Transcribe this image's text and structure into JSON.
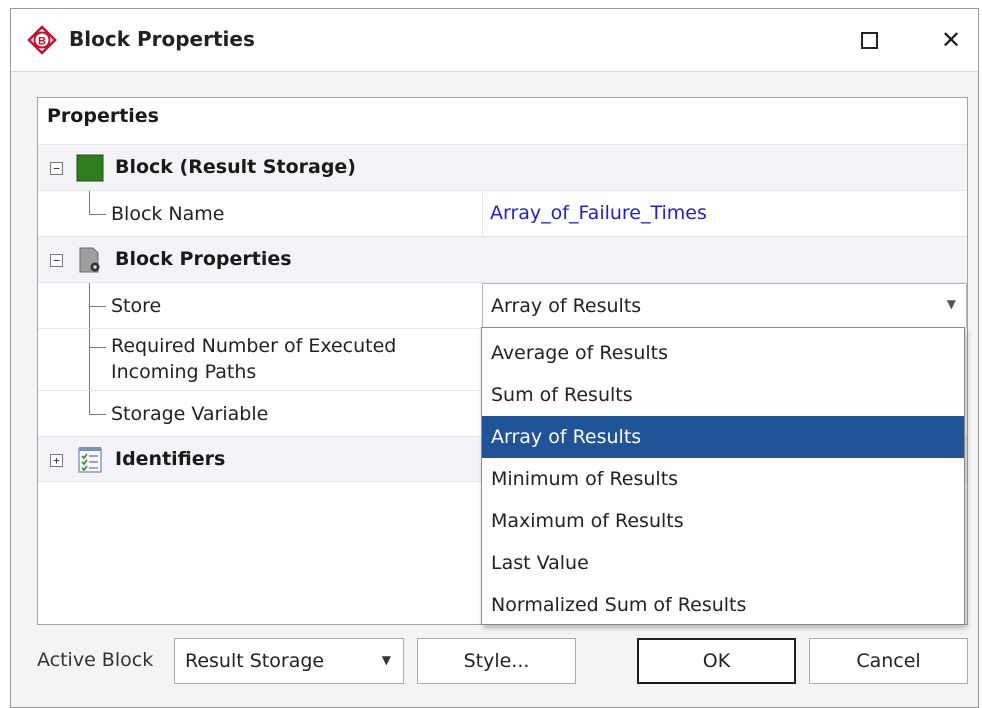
{
  "window": {
    "title": "Block Properties",
    "app_icon_letter": "B"
  },
  "grid": {
    "header": "Properties",
    "categories": [
      {
        "label": "Block (Result Storage)",
        "expander": "−",
        "icon": "green-block-icon",
        "properties": [
          {
            "label": "Block Name",
            "value": "Array_of_Failure_Times"
          }
        ]
      },
      {
        "label": "Block Properties",
        "expander": "−",
        "icon": "block-settings-icon",
        "properties": [
          {
            "label": "Store",
            "value": "Array of Results"
          },
          {
            "label": "Required Number of Executed Incoming Paths",
            "value": ""
          },
          {
            "label": "Storage Variable",
            "value": ""
          }
        ]
      },
      {
        "label": "Identifiers",
        "expander": "+",
        "icon": "checklist-icon",
        "properties": []
      }
    ]
  },
  "dropdown": {
    "options": [
      "Average of Results",
      "Sum of Results",
      "Array of Results",
      "Minimum of Results",
      "Maximum of Results",
      "Last Value",
      "Normalized Sum of Results"
    ],
    "selected_index": 2
  },
  "footer": {
    "active_block_label": "Active Block",
    "active_block_value": "Result Storage",
    "style_button": "Style...",
    "ok_button": "OK",
    "cancel_button": "Cancel"
  },
  "colors": {
    "selection": "#1f5496",
    "link": "#2020d0",
    "brand_red": "#c8102e"
  }
}
